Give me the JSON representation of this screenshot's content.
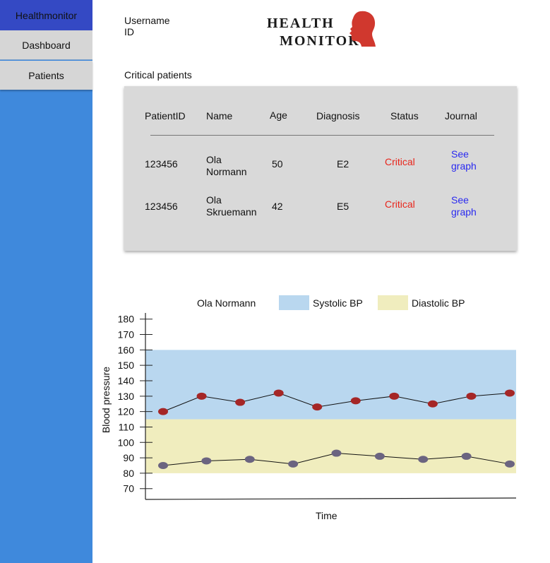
{
  "sidebar": {
    "brand": "Healthmonitor",
    "items": [
      {
        "label": "Dashboard"
      },
      {
        "label": "Patients"
      }
    ]
  },
  "user": {
    "username_label": "Username",
    "id_label": "ID"
  },
  "logo": {
    "line1": "HEALTH",
    "line2": "MONITOR",
    "head_color": "#d0382e"
  },
  "critical_section": {
    "title": "Critical patients",
    "columns": [
      "PatientID",
      "Name",
      "Age",
      "Diagnosis",
      "Status",
      "Journal"
    ],
    "rows": [
      {
        "id": "123456",
        "name_first": "Ola",
        "name_last": "Normann",
        "age": "50",
        "diagnosis": "E2",
        "status": "Critical",
        "journal_l1": "See",
        "journal_l2": "graph"
      },
      {
        "id": "123456",
        "name_first": "Ola",
        "name_last": "Skruemann",
        "age": "42",
        "diagnosis": "E5",
        "status": "Critical",
        "journal_l1": "See",
        "journal_l2": "graph"
      }
    ],
    "status_color": "#e8251b",
    "link_color": "#2a2af0"
  },
  "chart_data": {
    "type": "line",
    "patient": "Ola Normann",
    "ylabel": "Blood pressure",
    "xlabel": "Time",
    "y_ticks": [
      70,
      80,
      90,
      100,
      110,
      120,
      130,
      140,
      150,
      160,
      170,
      180
    ],
    "ylim": [
      63,
      184
    ],
    "x_count": 10,
    "bands": [
      {
        "name": "Systolic BP",
        "range": [
          115,
          160
        ],
        "color": "#b9d7ef"
      },
      {
        "name": "Diastolic BP",
        "range": [
          80,
          115
        ],
        "color": "#f0edbe"
      }
    ],
    "series": [
      {
        "values": [
          120,
          130,
          126,
          132,
          123,
          127,
          130,
          125,
          130,
          132
        ],
        "color": "#a52626"
      },
      {
        "values": [
          85,
          88,
          89,
          86,
          93,
          91,
          89,
          91,
          86
        ],
        "color": "#6b6480"
      }
    ]
  }
}
